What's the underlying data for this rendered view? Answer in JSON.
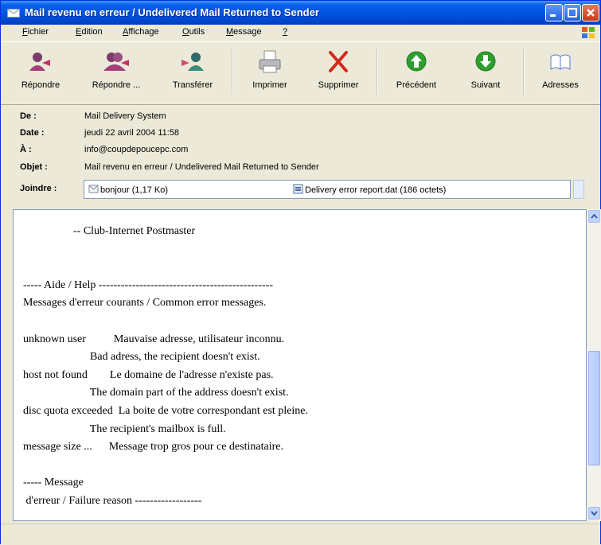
{
  "window": {
    "title": "Mail revenu en erreur / Undelivered Mail Returned to Sender"
  },
  "menu": [
    {
      "key": "F",
      "rest": "ichier"
    },
    {
      "key": "E",
      "rest": "dition"
    },
    {
      "key": "A",
      "rest": "ffichage"
    },
    {
      "key": "O",
      "rest": "utils"
    },
    {
      "key": "M",
      "rest": "essage"
    },
    {
      "key": "?",
      "rest": ""
    }
  ],
  "toolbar": {
    "reply": "Répondre",
    "reply_all": "Répondre ...",
    "forward": "Transférer",
    "print": "Imprimer",
    "delete": "Supprimer",
    "previous": "Précédent",
    "next": "Suivant",
    "addresses": "Adresses"
  },
  "headers": {
    "from_label": "De :",
    "from": "Mail Delivery System",
    "date_label": "Date :",
    "date": "jeudi 22 avril 2004 11:58",
    "to_label": "À :",
    "to": "info@coupdepoucepc.com",
    "subject_label": "Objet :",
    "subject": "Mail revenu en erreur / Undelivered Mail Returned to Sender",
    "attach_label": "Joindre :",
    "attachments": [
      "bonjour (1,17 Ko)",
      "Delivery error report.dat (186 octets)"
    ]
  },
  "body": {
    "text": "                  -- Club-Internet Postmaster\n\n\n----- Aide / Help -----------------------------------------------\nMessages d'erreur courants / Common error messages.\n\nunknown user          Mauvaise adresse, utilisateur inconnu.\n                        Bad adress, the recipient doesn't exist.\nhost not found        Le domaine de l'adresse n'existe pas.\n                        The domain part of the address doesn't exist.\ndisc quota exceeded  La boite de votre correspondant est pleine.\n                        The recipient's mailbox is full.\nmessage size ...      Message trop gros pour ce destinataire.\n\n----- Message\n d'erreur / Failure reason ------------------"
  },
  "colors": {
    "titlebar": "#0054e3",
    "chrome": "#ece9d8",
    "delete_red": "#d42a1b",
    "nav_green": "#2f9e2f"
  }
}
